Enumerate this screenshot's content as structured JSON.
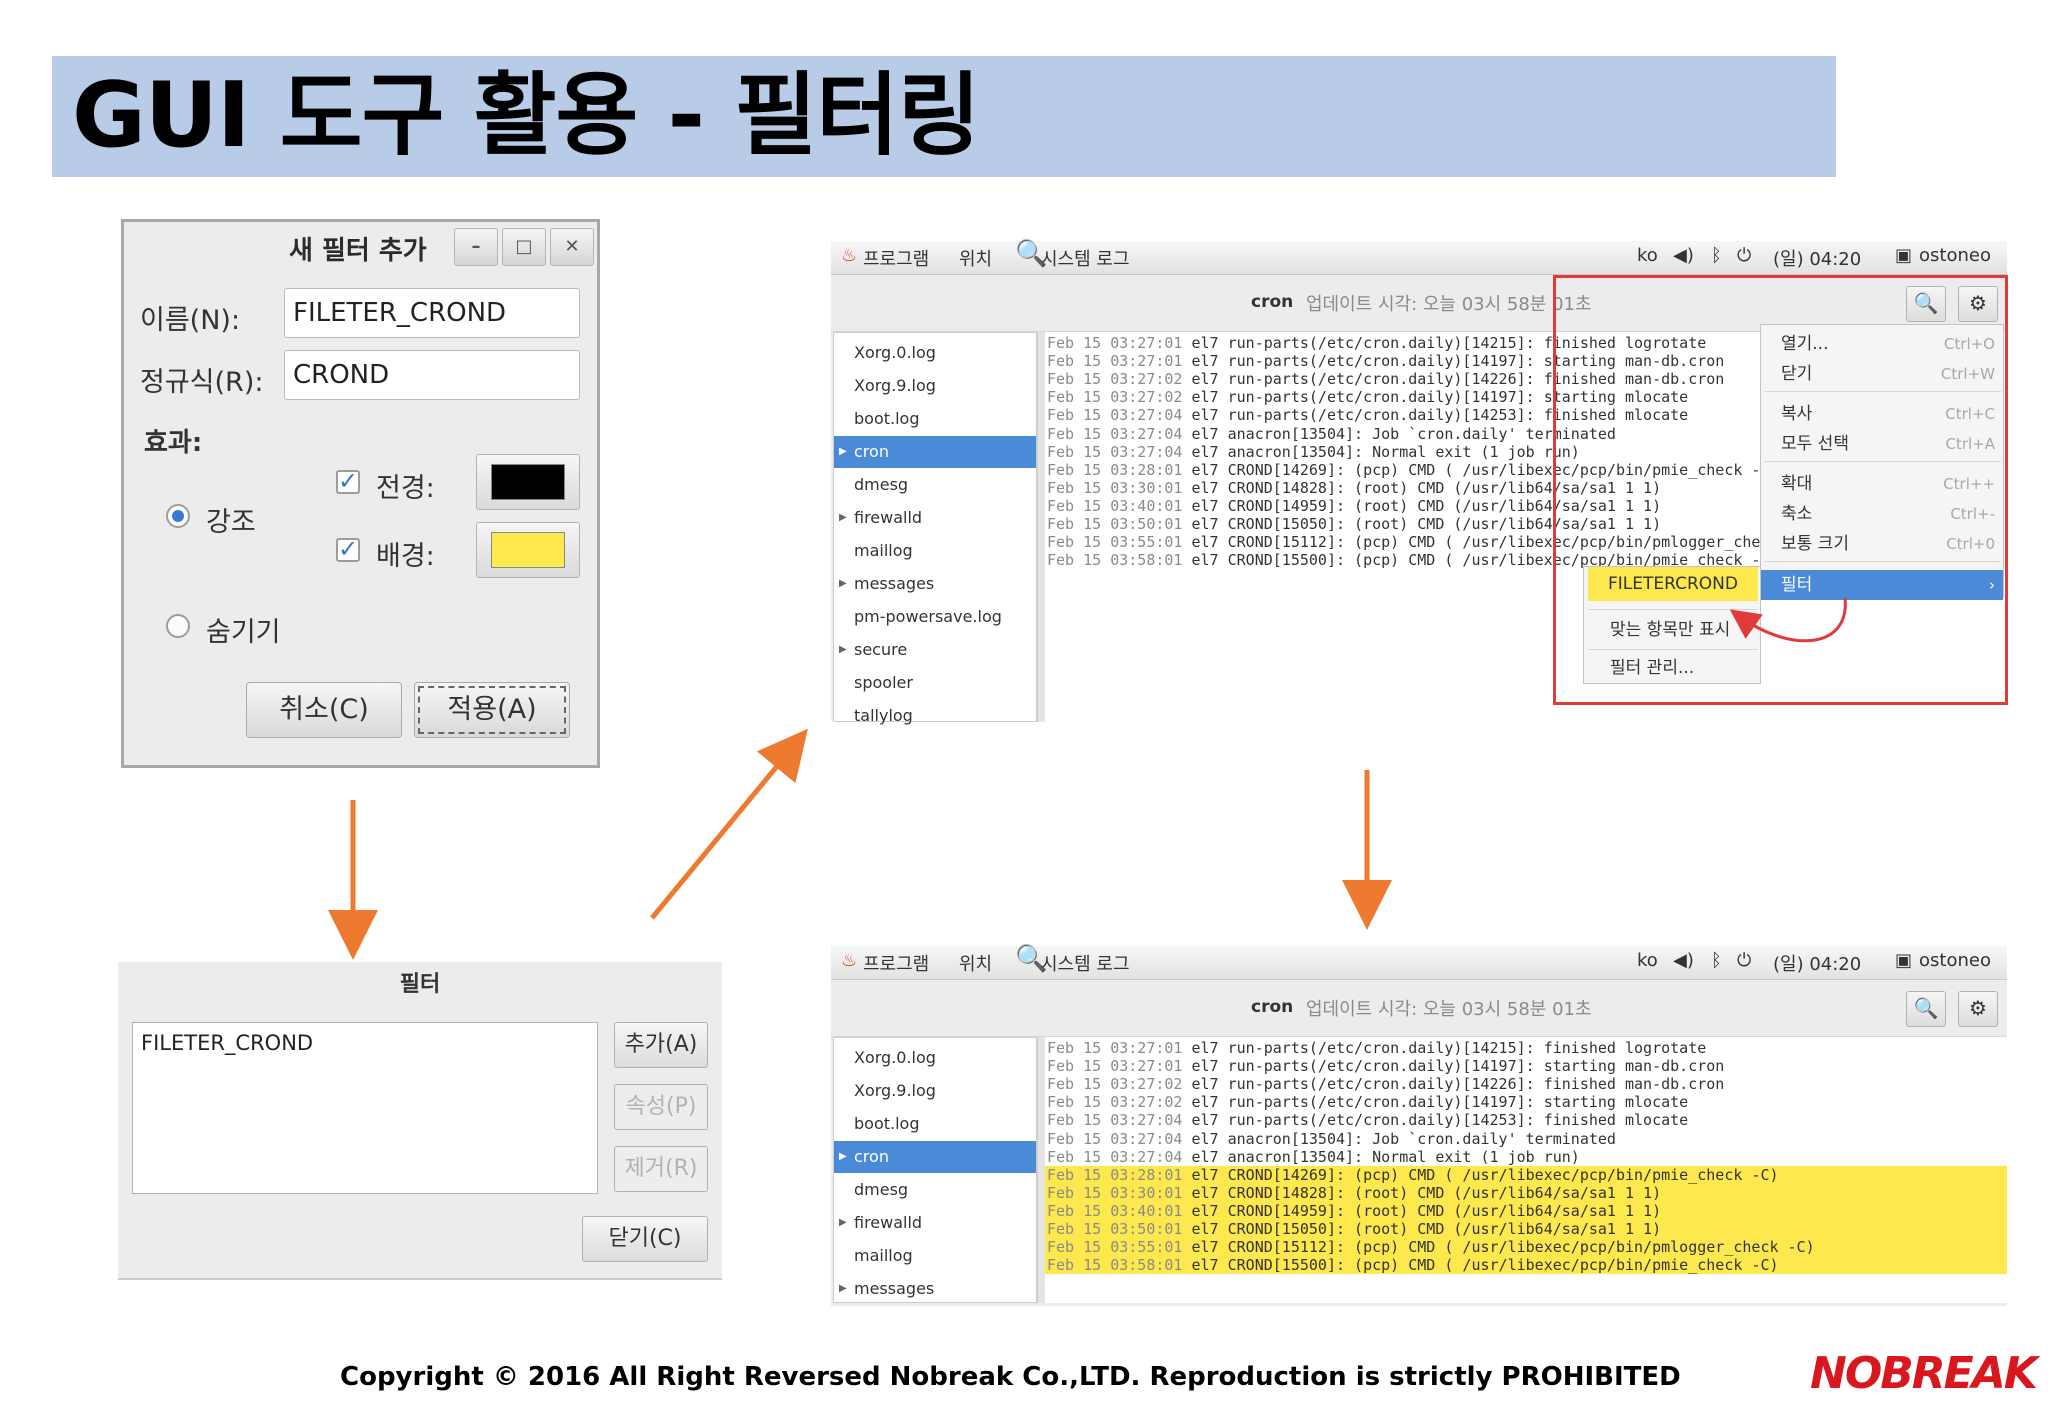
{
  "page_title": "GUI 도구 활용 - 필터링",
  "new_filter_dialog": {
    "title": "새 필터 추가",
    "minimize": "–",
    "maximize": "□",
    "close": "✕",
    "name_label": "이름(N):",
    "name_value": "FILETER_CROND",
    "regex_label": "정규식(R):",
    "regex_value": "CROND",
    "effect_label": "효과:",
    "highlight_label": "강조",
    "foreground_label": "전경:",
    "background_label": "배경:",
    "hide_label": "숨기기",
    "cancel_button": "취소(C)",
    "apply_button": "적용(A)",
    "foreground_color": "#000000",
    "background_color": "#fde84d",
    "highlight_selected": true
  },
  "filter_manager": {
    "title": "필터",
    "items": [
      "FILETER_CROND"
    ],
    "add_button": "추가(A)",
    "properties_button": "속성(P)",
    "remove_button": "제거(R)",
    "close_button": "닫기(C)"
  },
  "log_viewer": {
    "top_bar": {
      "applications": "프로그램",
      "places": "위치",
      "app_name": "시스템 로그",
      "lang": "ko",
      "clock": "(일) 04:20",
      "user": "ostoneo"
    },
    "header": {
      "log_name": "cron",
      "updated": "업데이트 시각: 오늘 03시 58분 01초"
    },
    "sidebar": [
      {
        "label": "Xorg.0.log",
        "expandable": false
      },
      {
        "label": "Xorg.9.log",
        "expandable": false
      },
      {
        "label": "boot.log",
        "expandable": false
      },
      {
        "label": "cron",
        "expandable": true
      },
      {
        "label": "dmesg",
        "expandable": false
      },
      {
        "label": "firewalld",
        "expandable": true
      },
      {
        "label": "maillog",
        "expandable": false
      },
      {
        "label": "messages",
        "expandable": true
      },
      {
        "label": "pm-powersave.log",
        "expandable": false
      },
      {
        "label": "secure",
        "expandable": true
      },
      {
        "label": "spooler",
        "expandable": false
      },
      {
        "label": "tallylog",
        "expandable": false
      }
    ],
    "selected_log": "cron",
    "lines": [
      {
        "date": "Feb 15 03:27:01",
        "text": " el7 run-parts(/etc/cron.daily)[14215]: finished logrotate",
        "match": false
      },
      {
        "date": "Feb 15 03:27:01",
        "text": " el7 run-parts(/etc/cron.daily)[14197]: starting man-db.cron",
        "match": false
      },
      {
        "date": "Feb 15 03:27:02",
        "text": " el7 run-parts(/etc/cron.daily)[14226]: finished man-db.cron",
        "match": false
      },
      {
        "date": "Feb 15 03:27:02",
        "text": " el7 run-parts(/etc/cron.daily)[14197]: starting mlocate",
        "match": false
      },
      {
        "date": "Feb 15 03:27:04",
        "text": " el7 run-parts(/etc/cron.daily)[14253]: finished mlocate",
        "match": false
      },
      {
        "date": "Feb 15 03:27:04",
        "text": " el7 anacron[13504]: Job `cron.daily' terminated",
        "match": false
      },
      {
        "date": "Feb 15 03:27:04",
        "text": " el7 anacron[13504]: Normal exit (1 job run)",
        "match": false
      },
      {
        "date": "Feb 15 03:28:01",
        "text": " el7 CROND[14269]: (pcp) CMD ( /usr/libexec/pcp/bin/pmie_check -C)",
        "match": true
      },
      {
        "date": "Feb 15 03:30:01",
        "text": " el7 CROND[14828]: (root) CMD (/usr/lib64/sa/sa1 1 1)",
        "match": true
      },
      {
        "date": "Feb 15 03:40:01",
        "text": " el7 CROND[14959]: (root) CMD (/usr/lib64/sa/sa1 1 1)",
        "match": true
      },
      {
        "date": "Feb 15 03:50:01",
        "text": " el7 CROND[15050]: (root) CMD (/usr/lib64/sa/sa1 1 1)",
        "match": true
      },
      {
        "date": "Feb 15 03:55:01",
        "text": " el7 CROND[15112]: (pcp) CMD ( /usr/libexec/pcp/bin/pmlogger_check -C)",
        "match": true
      },
      {
        "date": "Feb 15 03:58:01",
        "text": " el7 CROND[15500]: (pcp) CMD ( /usr/libexec/pcp/bin/pmie_check -C)",
        "match": true
      }
    ],
    "menu": {
      "items": [
        {
          "label": "열기...",
          "shortcut": "Ctrl+O"
        },
        {
          "label": "닫기",
          "shortcut": "Ctrl+W"
        },
        {
          "label": "복사",
          "shortcut": "Ctrl+C"
        },
        {
          "label": "모두 선택",
          "shortcut": "Ctrl+A"
        },
        {
          "label": "확대",
          "shortcut": "Ctrl++"
        },
        {
          "label": "축소",
          "shortcut": "Ctrl+-"
        },
        {
          "label": "보통 크기",
          "shortcut": "Ctrl+0"
        },
        {
          "label": "필터",
          "shortcut": "›"
        }
      ],
      "submenu": {
        "filter_name": "FILETERCROND",
        "show_matches_only": "맞는 항목만 표시",
        "manage_filters": "필터 관리..."
      }
    }
  },
  "copyright": "Copyright © 2016 All Right Reversed Nobreak Co.,LTD. Reproduction is strictly PROHIBITED",
  "logo_text": "NOBREAK",
  "colors": {
    "banner": "#b8cce8",
    "selection_blue": "#4a8ad6",
    "highlight_yellow": "#fde84d",
    "annotation_red": "#e03a3a",
    "arrow_orange": "#ee7a2f"
  }
}
